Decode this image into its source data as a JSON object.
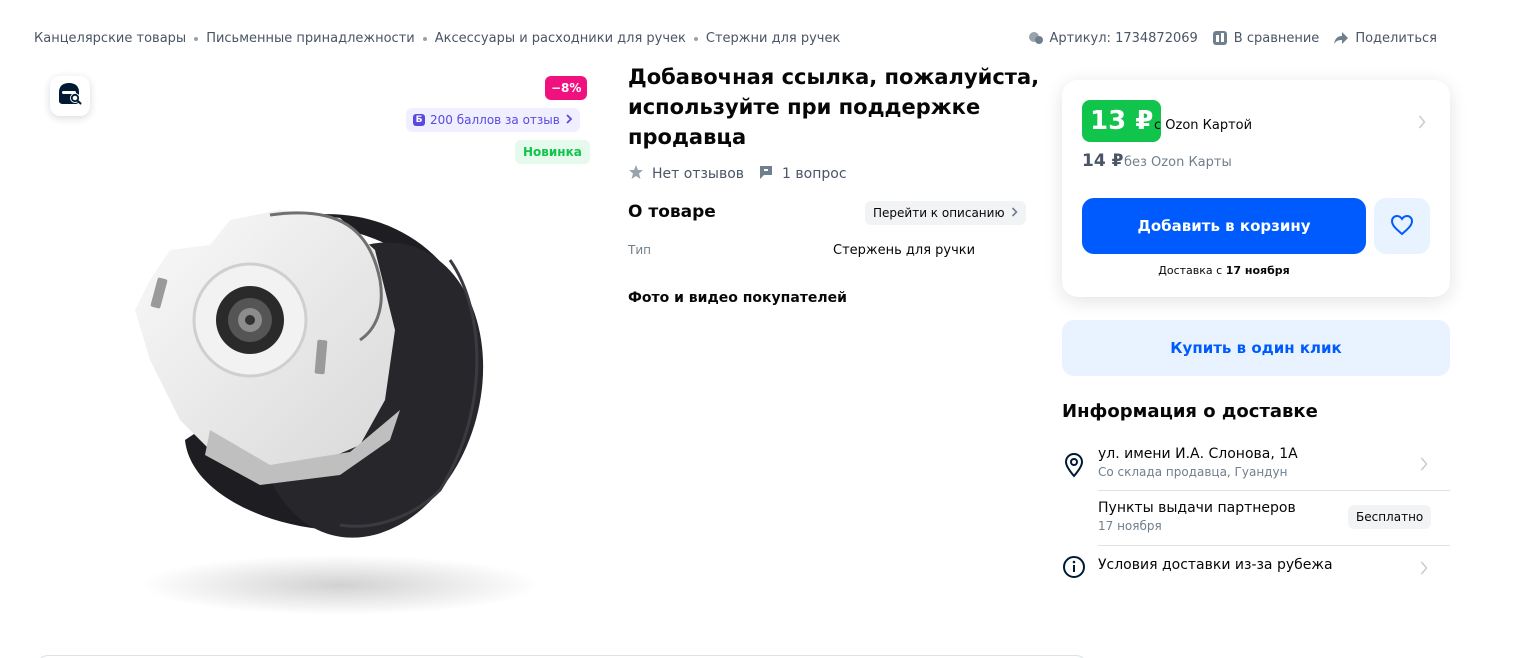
{
  "breadcrumbs": [
    "Канцелярские товары",
    "Письменные принадлежности",
    "Аксессуары и расходники для ручек",
    "Стержни для ручек"
  ],
  "top_actions": {
    "article": "Артикул: 1734872069",
    "compare": "В сравнение",
    "share": "Поделиться"
  },
  "gallery": {
    "discount_badge": "−8%",
    "points_badge": "200 баллов за отзыв",
    "points_icon_letter": "Б",
    "new_badge": "Новинка"
  },
  "product": {
    "title": "Добавочная ссылка, пожалуйста, используйте при поддержке продавца",
    "reviews": "Нет отзывов",
    "questions": "1 вопрос",
    "about_title": "О товаре",
    "to_description": "Перейти к описанию",
    "spec_name": "Тип",
    "spec_value": "Стержень для ручки",
    "ugc_title": "Фото и видео покупателей"
  },
  "price_card": {
    "price_card": "13 ₽",
    "price_card_label": "с Ozon Картой",
    "price_regular": "14 ₽",
    "price_regular_label": "без Ozon Карты",
    "add_to_cart": "Добавить в корзину",
    "delivery_prefix": "Доставка с",
    "delivery_date": "17 ноября"
  },
  "one_click": "Купить в один клик",
  "delivery": {
    "title": "Информация о доставке",
    "address": "ул. имени И.А. Слонова, 1А",
    "address_sub": "Со склада продавца, Гуандун",
    "pickup": "Пункты выдачи партнеров",
    "pickup_date": "17 ноября",
    "pickup_price": "Бесплатно",
    "conditions": "Условия доставки из-за рубежа"
  },
  "colors": {
    "brand_blue": "#005bff",
    "price_green": "#10c44c",
    "discount_pink": "#f1117e",
    "points_purple": "#5b4adf"
  }
}
